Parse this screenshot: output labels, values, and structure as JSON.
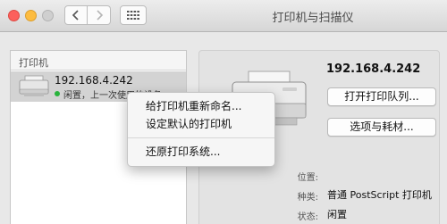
{
  "window": {
    "title": "打印机与扫描仪"
  },
  "toolbar": {
    "back_icon": "chevron-left-icon",
    "forward_icon": "chevron-right-icon",
    "grid_icon": "grid-icon"
  },
  "printers_list": {
    "header": "打印机",
    "items": [
      {
        "name": "192.168.4.242",
        "status": "闲置，上一次使用的设备",
        "status_color": "#29b33c",
        "selected": true
      }
    ]
  },
  "context_menu": {
    "items": [
      {
        "label": "给打印机重新命名..."
      },
      {
        "label": "设定默认的打印机"
      },
      {
        "label": "还原打印系统..."
      }
    ]
  },
  "details": {
    "printer_name": "192.168.4.242",
    "open_queue_label": "打开打印队列...",
    "options_label": "选项与耗材...",
    "location_label": "位置:",
    "location_value": "",
    "kind_label": "种类:",
    "kind_value": "普通 PostScript 打印机",
    "status_label": "状态:",
    "status_value": "闲置"
  }
}
